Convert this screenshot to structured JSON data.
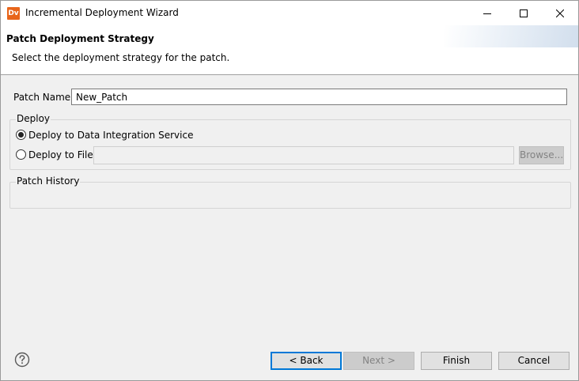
{
  "window": {
    "title": "Incremental Deployment Wizard",
    "icon_text": "Dv",
    "icon_color": "#e8651a"
  },
  "header": {
    "title": "Patch Deployment Strategy",
    "description": "Select the deployment strategy for the patch."
  },
  "form": {
    "patch_name_label": "Patch Name:",
    "patch_name_value": "New_Patch",
    "deploy_group": {
      "legend": "Deploy",
      "options": [
        {
          "label": "Deploy to Data Integration Service",
          "selected": true
        },
        {
          "label": "Deploy to File",
          "selected": false
        }
      ],
      "file_path_value": "",
      "browse_label": "Browse..."
    },
    "history_group": {
      "legend": "Patch History"
    }
  },
  "footer": {
    "help_icon": "question-mark-icon",
    "back_label": "< Back",
    "next_label": "Next >",
    "finish_label": "Finish",
    "cancel_label": "Cancel"
  },
  "colors": {
    "accent": "#0078d7",
    "panel_bg": "#f0f0f0",
    "disabled_text": "#838383"
  }
}
